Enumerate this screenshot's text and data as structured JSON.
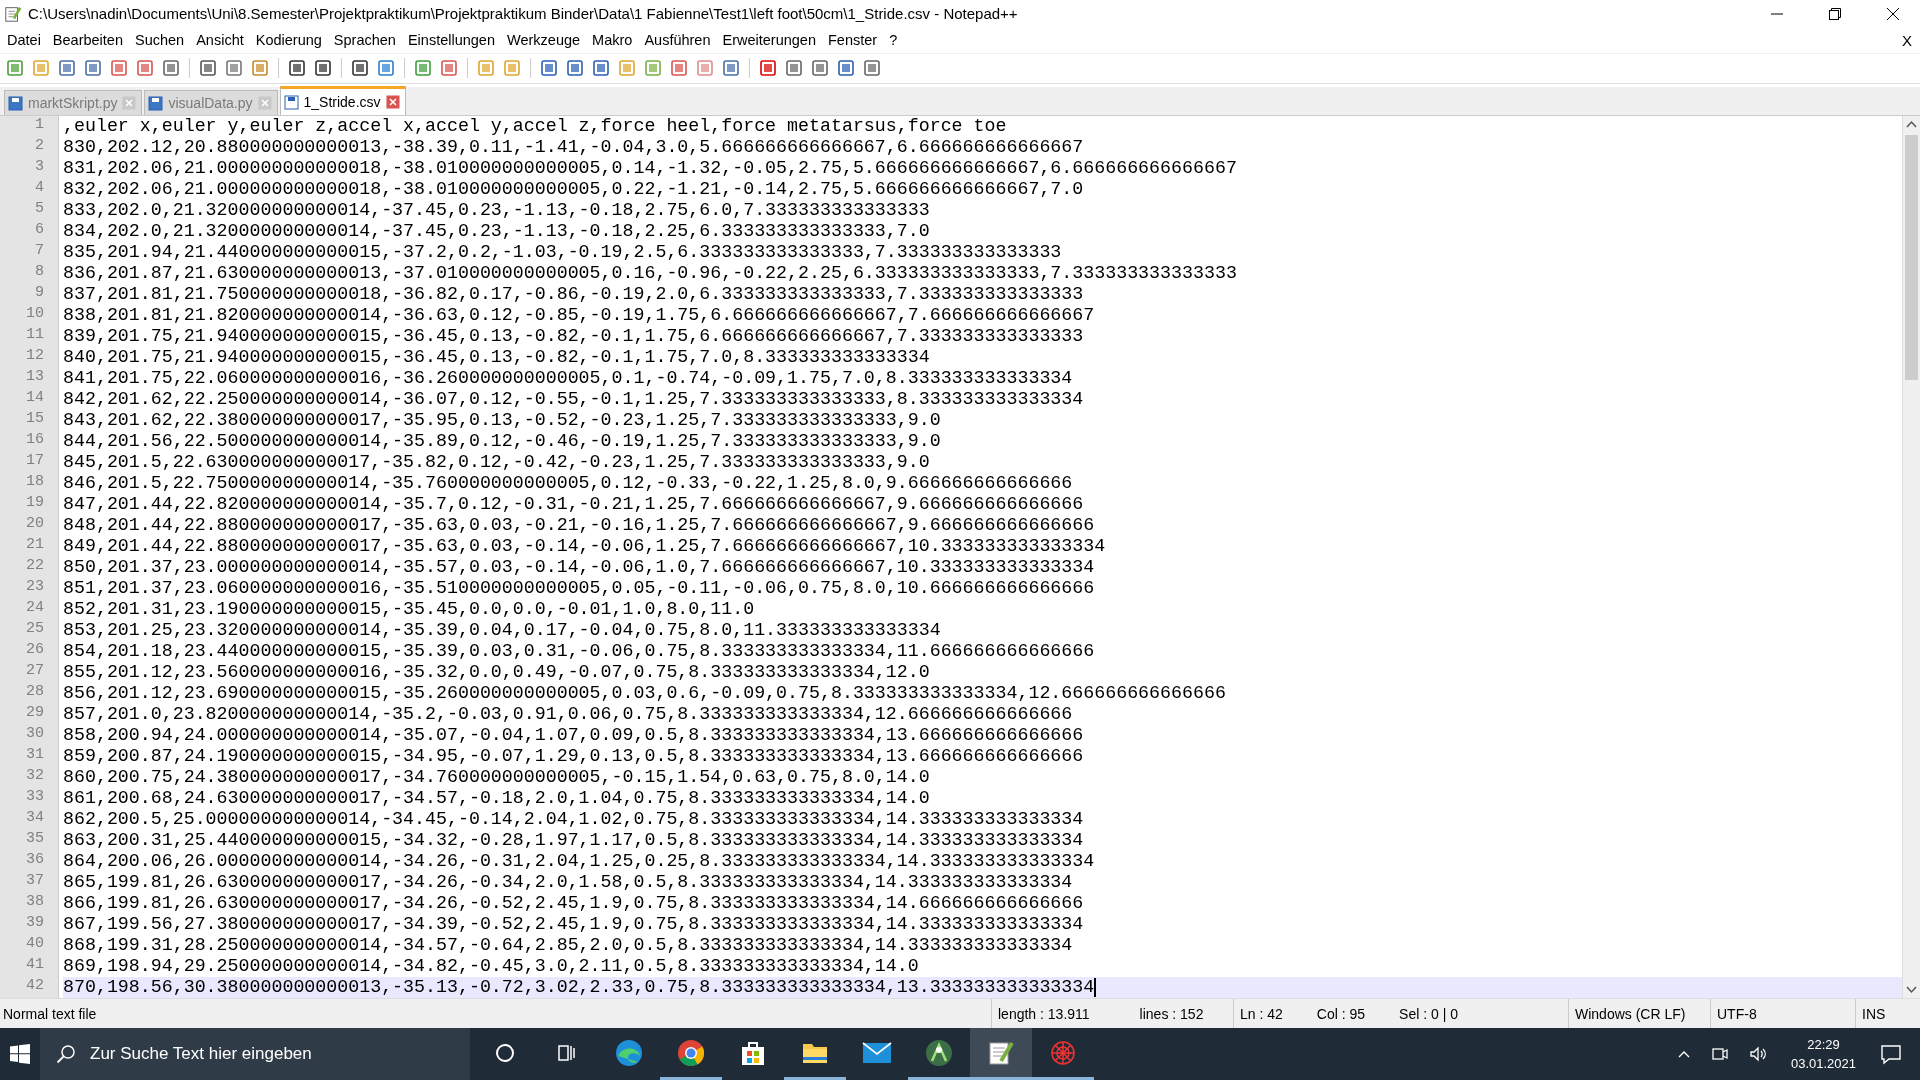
{
  "window": {
    "title": "C:\\Users\\nadin\\Documents\\Uni\\8.Semester\\Projektpraktikum\\Projektpraktikum Binder\\Data\\1 Fabienne\\Test1\\left foot\\50cm\\1_Stride.csv - Notepad++"
  },
  "menu": [
    "Datei",
    "Bearbeiten",
    "Suchen",
    "Ansicht",
    "Kodierung",
    "Sprachen",
    "Einstellungen",
    "Werkzeuge",
    "Makro",
    "Ausführen",
    "Erweiterungen",
    "Fenster",
    "?"
  ],
  "menu_close": "X",
  "tabs": [
    {
      "label": "marktSkript.py",
      "selected": false
    },
    {
      "label": "visualData.py",
      "selected": false
    },
    {
      "label": "1_Stride.csv",
      "selected": true
    }
  ],
  "lines": [
    {
      "number": "1",
      "text": ",euler x,euler y,euler z,accel x,accel y,accel z,force heel,force metatarsus,force toe",
      "current": false
    },
    {
      "number": "2",
      "text": "830,202.12,20.880000000000013,-38.39,0.11,-1.41,-0.04,3.0,5.666666666666667,6.666666666666667",
      "current": false
    },
    {
      "number": "3",
      "text": "831,202.06,21.000000000000018,-38.010000000000005,0.14,-1.32,-0.05,2.75,5.666666666666667,6.666666666666667",
      "current": false
    },
    {
      "number": "4",
      "text": "832,202.06,21.000000000000018,-38.010000000000005,0.22,-1.21,-0.14,2.75,5.666666666666667,7.0",
      "current": false
    },
    {
      "number": "5",
      "text": "833,202.0,21.320000000000014,-37.45,0.23,-1.13,-0.18,2.75,6.0,7.333333333333333",
      "current": false
    },
    {
      "number": "6",
      "text": "834,202.0,21.320000000000014,-37.45,0.23,-1.13,-0.18,2.25,6.333333333333333,7.0",
      "current": false
    },
    {
      "number": "7",
      "text": "835,201.94,21.440000000000015,-37.2,0.2,-1.03,-0.19,2.5,6.333333333333333,7.333333333333333",
      "current": false
    },
    {
      "number": "8",
      "text": "836,201.87,21.630000000000013,-37.010000000000005,0.16,-0.96,-0.22,2.25,6.333333333333333,7.333333333333333",
      "current": false
    },
    {
      "number": "9",
      "text": "837,201.81,21.750000000000018,-36.82,0.17,-0.86,-0.19,2.0,6.333333333333333,7.333333333333333",
      "current": false
    },
    {
      "number": "10",
      "text": "838,201.81,21.820000000000014,-36.63,0.12,-0.85,-0.19,1.75,6.666666666666667,7.666666666666667",
      "current": false
    },
    {
      "number": "11",
      "text": "839,201.75,21.940000000000015,-36.45,0.13,-0.82,-0.1,1.75,6.666666666666667,7.333333333333333",
      "current": false
    },
    {
      "number": "12",
      "text": "840,201.75,21.940000000000015,-36.45,0.13,-0.82,-0.1,1.75,7.0,8.333333333333334",
      "current": false
    },
    {
      "number": "13",
      "text": "841,201.75,22.060000000000016,-36.260000000000005,0.1,-0.74,-0.09,1.75,7.0,8.333333333333334",
      "current": false
    },
    {
      "number": "14",
      "text": "842,201.62,22.250000000000014,-36.07,0.12,-0.55,-0.1,1.25,7.333333333333333,8.333333333333334",
      "current": false
    },
    {
      "number": "15",
      "text": "843,201.62,22.380000000000017,-35.95,0.13,-0.52,-0.23,1.25,7.333333333333333,9.0",
      "current": false
    },
    {
      "number": "16",
      "text": "844,201.56,22.500000000000014,-35.89,0.12,-0.46,-0.19,1.25,7.333333333333333,9.0",
      "current": false
    },
    {
      "number": "17",
      "text": "845,201.5,22.630000000000017,-35.82,0.12,-0.42,-0.23,1.25,7.333333333333333,9.0",
      "current": false
    },
    {
      "number": "18",
      "text": "846,201.5,22.750000000000014,-35.760000000000005,0.12,-0.33,-0.22,1.25,8.0,9.666666666666666",
      "current": false
    },
    {
      "number": "19",
      "text": "847,201.44,22.820000000000014,-35.7,0.12,-0.31,-0.21,1.25,7.666666666666667,9.666666666666666",
      "current": false
    },
    {
      "number": "20",
      "text": "848,201.44,22.880000000000017,-35.63,0.03,-0.21,-0.16,1.25,7.666666666666667,9.666666666666666",
      "current": false
    },
    {
      "number": "21",
      "text": "849,201.44,22.880000000000017,-35.63,0.03,-0.14,-0.06,1.25,7.666666666666667,10.333333333333334",
      "current": false
    },
    {
      "number": "22",
      "text": "850,201.37,23.000000000000014,-35.57,0.03,-0.14,-0.06,1.0,7.666666666666667,10.333333333333334",
      "current": false
    },
    {
      "number": "23",
      "text": "851,201.37,23.060000000000016,-35.510000000000005,0.05,-0.11,-0.06,0.75,8.0,10.666666666666666",
      "current": false
    },
    {
      "number": "24",
      "text": "852,201.31,23.190000000000015,-35.45,0.0,0.0,-0.01,1.0,8.0,11.0",
      "current": false
    },
    {
      "number": "25",
      "text": "853,201.25,23.320000000000014,-35.39,0.04,0.17,-0.04,0.75,8.0,11.333333333333334",
      "current": false
    },
    {
      "number": "26",
      "text": "854,201.18,23.440000000000015,-35.39,0.03,0.31,-0.06,0.75,8.333333333333334,11.666666666666666",
      "current": false
    },
    {
      "number": "27",
      "text": "855,201.12,23.560000000000016,-35.32,0.0,0.49,-0.07,0.75,8.333333333333334,12.0",
      "current": false
    },
    {
      "number": "28",
      "text": "856,201.12,23.690000000000015,-35.260000000000005,0.03,0.6,-0.09,0.75,8.333333333333334,12.666666666666666",
      "current": false
    },
    {
      "number": "29",
      "text": "857,201.0,23.820000000000014,-35.2,-0.03,0.91,0.06,0.75,8.333333333333334,12.666666666666666",
      "current": false
    },
    {
      "number": "30",
      "text": "858,200.94,24.000000000000014,-35.07,-0.04,1.07,0.09,0.5,8.333333333333334,13.666666666666666",
      "current": false
    },
    {
      "number": "31",
      "text": "859,200.87,24.190000000000015,-34.95,-0.07,1.29,0.13,0.5,8.333333333333334,13.666666666666666",
      "current": false
    },
    {
      "number": "32",
      "text": "860,200.75,24.380000000000017,-34.760000000000005,-0.15,1.54,0.63,0.75,8.0,14.0",
      "current": false
    },
    {
      "number": "33",
      "text": "861,200.68,24.630000000000017,-34.57,-0.18,2.0,1.04,0.75,8.333333333333334,14.0",
      "current": false
    },
    {
      "number": "34",
      "text": "862,200.5,25.000000000000014,-34.45,-0.14,2.04,1.02,0.75,8.333333333333334,14.333333333333334",
      "current": false
    },
    {
      "number": "35",
      "text": "863,200.31,25.440000000000015,-34.32,-0.28,1.97,1.17,0.5,8.333333333333334,14.333333333333334",
      "current": false
    },
    {
      "number": "36",
      "text": "864,200.06,26.000000000000014,-34.26,-0.31,2.04,1.25,0.25,8.333333333333334,14.333333333333334",
      "current": false
    },
    {
      "number": "37",
      "text": "865,199.81,26.630000000000017,-34.26,-0.34,2.0,1.58,0.5,8.333333333333334,14.333333333333334",
      "current": false
    },
    {
      "number": "38",
      "text": "866,199.81,26.630000000000017,-34.26,-0.52,2.45,1.9,0.75,8.333333333333334,14.666666666666666",
      "current": false
    },
    {
      "number": "39",
      "text": "867,199.56,27.380000000000017,-34.39,-0.52,2.45,1.9,0.75,8.333333333333334,14.333333333333334",
      "current": false
    },
    {
      "number": "40",
      "text": "868,199.31,28.250000000000014,-34.57,-0.64,2.85,2.0,0.5,8.333333333333334,14.333333333333334",
      "current": false
    },
    {
      "number": "41",
      "text": "869,198.94,29.250000000000014,-34.82,-0.45,3.0,2.11,0.5,8.333333333333334,14.0",
      "current": false
    },
    {
      "number": "42",
      "text": "870,198.56,30.380000000000013,-35.13,-0.72,3.02,2.33,0.75,8.333333333333334,13.333333333333334",
      "current": true
    }
  ],
  "status_bar": {
    "doc_type": "Normal text file",
    "length": "length : 13.911",
    "lines": "lines : 152",
    "ln": "Ln : 42",
    "col": "Col : 95",
    "sel": "Sel : 0 | 0",
    "eol": "Windows (CR LF)",
    "encoding": "UTF-8",
    "mode": "INS"
  },
  "taskbar": {
    "search": {
      "placeholder": "Zur Suche Text hier eingeben"
    },
    "apps": [
      {
        "kind": "circle",
        "running": false,
        "selected": false
      },
      {
        "kind": "task-view",
        "running": false,
        "selected": false
      },
      {
        "kind": "browser-wave",
        "running": false,
        "selected": false
      },
      {
        "kind": "browser-ring",
        "running": true,
        "selected": false
      },
      {
        "kind": "bag",
        "running": false,
        "selected": false
      },
      {
        "kind": "folder",
        "running": true,
        "selected": false
      },
      {
        "kind": "envelope",
        "running": false,
        "selected": false
      },
      {
        "kind": "robot",
        "running": true,
        "selected": false
      },
      {
        "kind": "notepad",
        "running": true,
        "selected": true
      },
      {
        "kind": "web",
        "running": true,
        "selected": false
      }
    ],
    "time": "22:29",
    "date": "03.01.2021"
  }
}
